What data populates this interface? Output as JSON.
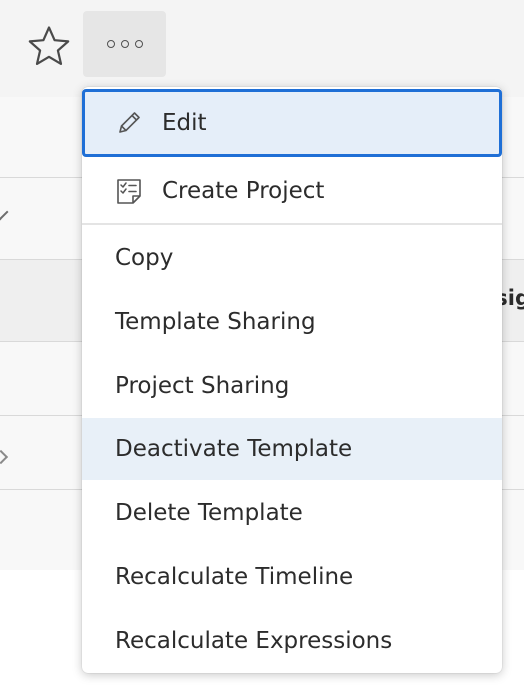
{
  "background": {
    "column_header_fragment": "sig"
  },
  "toolbar": {
    "favorite_icon": "star-icon",
    "more_icon": "more-horizontal-icon"
  },
  "menu": {
    "items": [
      {
        "label": "Edit",
        "icon": "pencil-icon",
        "state": "focused"
      },
      {
        "label": "Create Project",
        "icon": "checklist-document-icon"
      },
      {
        "label": "Copy"
      },
      {
        "label": "Template Sharing"
      },
      {
        "label": "Project Sharing"
      },
      {
        "label": "Deactivate Template",
        "state": "hovered"
      },
      {
        "label": "Delete Template"
      },
      {
        "label": "Recalculate Timeline"
      },
      {
        "label": "Recalculate Expressions"
      }
    ]
  },
  "colors": {
    "focus_ring": "#1f6fd6",
    "focused_item_bg": "#e5eef9",
    "hovered_item_bg": "#e8f0f8",
    "text": "#2c2c2c",
    "toolbar_button_bg": "#e6e6e6"
  }
}
